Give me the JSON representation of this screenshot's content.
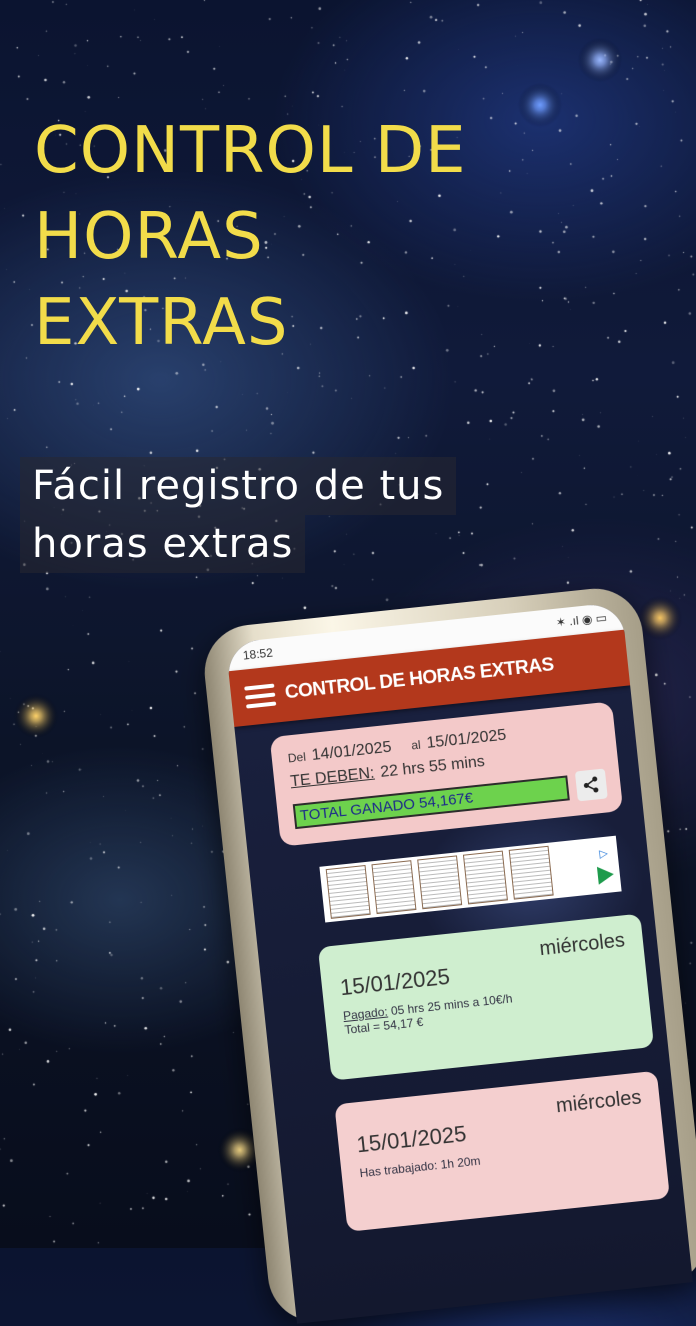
{
  "headline": [
    "CONTROL DE",
    "HORAS",
    "EXTRAS"
  ],
  "subtitle": [
    "Fácil registro de tus",
    "horas extras"
  ],
  "colors": {
    "headline": "#f2dc4a",
    "app_bar": "#b3381c",
    "summary_card": "#f3c9c9",
    "total_bar": "#6dd24d",
    "entry_green": "#cfeecf",
    "entry_pink": "#f4cfcf"
  },
  "phone": {
    "status_time": "18:52",
    "status_icons": "✶ .ıl ◉ ▭",
    "app_title": "CONTROL DE HORAS EXTRAS",
    "menu_icon": "hamburger-icon",
    "summary": {
      "from_label": "Del",
      "from_date": "14/01/2025",
      "to_label": "al",
      "to_date": "15/01/2025",
      "owed_label": "TE DEBEN:",
      "owed_value": "22 hrs 55 mins",
      "total_label": "TOTAL GANADO 54,167€",
      "share_icon": "share-icon"
    },
    "ad": {
      "choices_icon": "ad-choices-icon",
      "play_icon": "play-icon"
    },
    "entries": [
      {
        "date": "15/01/2025",
        "weekday": "miércoles",
        "line1_label": "Pagado:",
        "line1_value": "05 hrs 25 mins a 10€/h",
        "line2": "Total = 54,17 €"
      },
      {
        "date": "15/01/2025",
        "weekday": "miércoles",
        "line1_label": "Has trabajado:",
        "line1_value": "1h 20m"
      }
    ]
  }
}
